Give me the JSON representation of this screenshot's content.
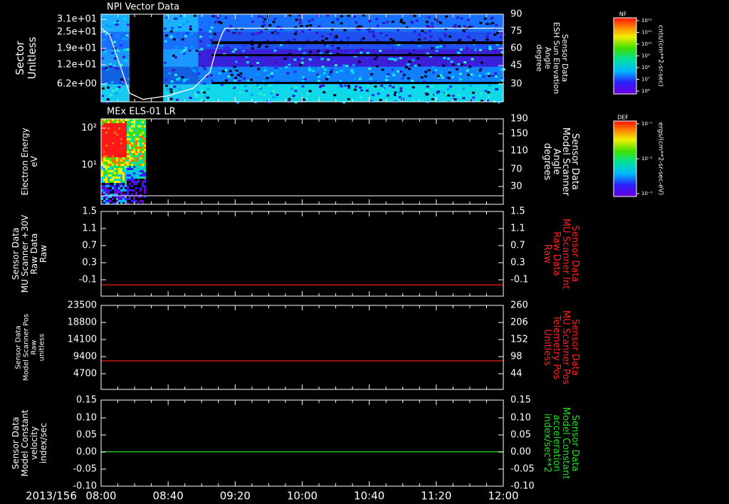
{
  "x_axis": {
    "ticks": [
      "08:00",
      "08:40",
      "09:20",
      "10:00",
      "10:40",
      "11:20",
      "12:00"
    ],
    "date_label": "2013/156",
    "range_minutes": [
      0,
      240
    ]
  },
  "panels": [
    {
      "title": "NPI Vector Data",
      "left_label": [
        "Sector",
        "Unitless"
      ],
      "left_ticks": [
        "3.1e+01",
        "2.5e+01",
        "1.9e+01",
        "1.2e+01",
        "6.2e+00"
      ],
      "right_label": [
        "Sensor Data",
        "ESH Sun Elevation",
        "Angle",
        "degree"
      ],
      "right_ticks": [
        "90",
        "75",
        "60",
        "45",
        "30"
      ],
      "colorbar": {
        "label": "NF",
        "unit": "cnts/(cm**2-sr-sec)",
        "ticks": [
          "10¹²",
          "10¹¹",
          "10¹⁰",
          "10⁹",
          "10⁸",
          "10⁷",
          "10⁶"
        ]
      }
    },
    {
      "title": "MEx ELS-01 LR",
      "left_label": [
        "Electron Energy",
        "eV"
      ],
      "left_ticks": [
        "10²",
        "10¹"
      ],
      "right_label": [
        "Sensor Data",
        "Model Scanner",
        "Angle",
        "degrees"
      ],
      "right_ticks": [
        "190",
        "150",
        "110",
        "70",
        "30"
      ],
      "colorbar": {
        "label": "DEF",
        "unit": "ergs/(cm**2-sr-sec-eV)",
        "ticks": [
          "10⁻¹",
          "10⁻²",
          "10⁻³"
        ]
      }
    },
    {
      "title": "",
      "left_label": [
        "Sensor Data",
        "MU Scanner +30V",
        "Raw Data",
        "Raw"
      ],
      "left_ticks": [
        "1.5",
        "1.1",
        "0.7",
        "0.3",
        "-0.1"
      ],
      "right_label": [
        "Sensor Data",
        "MU Scanner Int",
        "Raw Data",
        "Raw"
      ],
      "right_ticks": [
        "1.5",
        "1.1",
        "0.7",
        "0.3",
        "-0.1"
      ]
    },
    {
      "title": "",
      "left_label": [
        "Sensor Data",
        "Model Scanner Pos",
        "Raw",
        "unitless"
      ],
      "left_ticks": [
        "23500",
        "18800",
        "14100",
        "9400",
        "4700"
      ],
      "right_label": [
        "Sensor Data",
        "MU Scanner Pos",
        "Telemetry Pos",
        "Unitless"
      ],
      "right_ticks": [
        "260",
        "206",
        "152",
        "98",
        "44"
      ]
    },
    {
      "title": "",
      "left_label": [
        "Sensor Data",
        "Model Constant",
        "velocity",
        "index/sec"
      ],
      "left_ticks": [
        "0.15",
        "0.10",
        "0.05",
        "0.00",
        "-0.05",
        "-0.10"
      ],
      "right_label": [
        "Sensor Data",
        "Model Constant",
        "acceleration",
        "index/sec**2"
      ],
      "right_ticks": [
        "0.15",
        "0.10",
        "0.05",
        "0.00",
        "-0.05",
        "-0.10"
      ]
    }
  ],
  "chart_data": [
    {
      "type": "heatmap",
      "title": "NPI Vector Data",
      "xlabel": "",
      "ylabel": "Sector Unitless",
      "y2label": "Sensor Data ESH Sun Elevation Angle degree",
      "data_gaps_minutes": [
        [
          17,
          37
        ]
      ],
      "overlay_line": {
        "name": "ESH Sun Elevation Angle",
        "x": [
          0,
          5,
          17,
          25,
          40,
          55,
          65,
          68,
          72,
          74,
          90,
          240
        ],
        "y": [
          80,
          75,
          28,
          23,
          26,
          32,
          45,
          60,
          75,
          80,
          80,
          80
        ]
      }
    },
    {
      "type": "heatmap",
      "title": "MEx ELS-01 LR",
      "ylabel": "Electron Energy eV",
      "y2label": "Sensor Data Model Scanner Angle degrees",
      "data_range_minutes": [
        0,
        26
      ],
      "overlay_line": {
        "name": "Model Scanner Angle",
        "x": [
          0,
          240
        ],
        "y": [
          0,
          0
        ]
      }
    },
    {
      "type": "line",
      "ylim": [
        -0.3,
        1.5
      ],
      "y2lim": [
        -0.3,
        1.5
      ],
      "series": [
        {
          "name": "MU Scanner Int Raw Data",
          "color": "#ff2020",
          "x": [
            0,
            240
          ],
          "y": [
            -0.06,
            -0.06
          ]
        }
      ]
    },
    {
      "type": "line",
      "ylim": [
        0,
        23500
      ],
      "y2lim": [
        0,
        260
      ],
      "series": [
        {
          "name": "MU Scanner Pos Telemetry Pos",
          "color": "#ff2020",
          "x": [
            0,
            240
          ],
          "y": [
            8000,
            8000
          ]
        }
      ]
    },
    {
      "type": "line",
      "ylim": [
        -0.1,
        0.15
      ],
      "y2lim": [
        -0.1,
        0.15
      ],
      "series": [
        {
          "name": "Model Constant acceleration",
          "color": "#20dd20",
          "x": [
            0,
            240
          ],
          "y": [
            0.0,
            0.0
          ]
        }
      ]
    }
  ],
  "colors": {
    "red_label": "#ff2020",
    "green_label": "#20dd20",
    "text": "#ffffff"
  }
}
